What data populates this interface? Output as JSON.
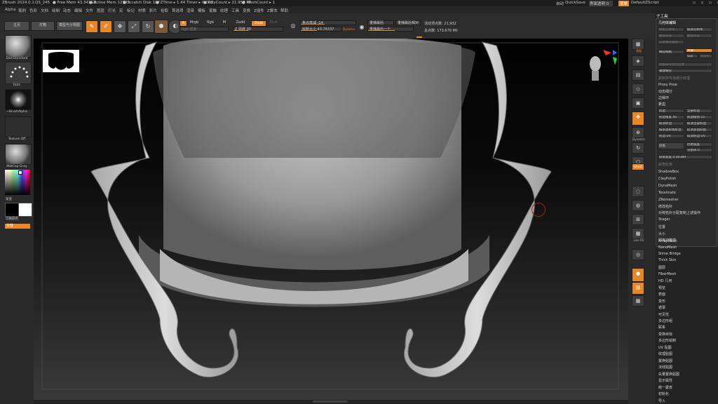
{
  "titlebar": {
    "app": "ZBrush 2024.0.1",
    "file": "QS_245",
    "free_mem": "● Free Mem 43.341GB",
    "active_mem": "● Active Mem 12732",
    "scratch": "● Scratch Disk 107",
    "ztime": "● ZTime ▸ 1.44 Timer ▸ 0.002",
    "polycount": "● PolyCount ▸ 21.958 KP",
    "meshcount": "● MeshCount ▸ 1",
    "autosave": "自动",
    "quicksave": "QuickSave",
    "transparency": "界面透明 0",
    "menus_btn": "菜单",
    "zscript": "DefaultZScript"
  },
  "menubar": [
    "Alpha",
    "笔刷",
    "色彩",
    "文档",
    "绘制",
    "动态",
    "编辑",
    "文件",
    "图层",
    "灯光",
    "宏",
    "标记",
    "材质",
    "影片",
    "拾取",
    "首选项",
    "渲染",
    "模板",
    "笔触",
    "纹理",
    "工具",
    "变换",
    "Z插件",
    "Z脚本",
    "帮助"
  ],
  "topshelf": {
    "home": "主页",
    "lightbox": "灯箱",
    "spotlight": "模型与分裂图",
    "edit": "编辑",
    "draw": "绘制",
    "move": "移动",
    "scale": "缩放",
    "rotate": "旋转",
    "a": "A",
    "mrgb": "Mrgb",
    "rgb": "Rgb",
    "m": "M",
    "zadd": "Zadd",
    "zsub": "Zsub",
    "zcut": "Zcut",
    "rgb_intensity": "Rgb 强度",
    "z_intensity": "Z 强度 30",
    "focal_shift": "焦点衰减 -14",
    "draw_size": "绘制大小 43.76337",
    "dynamic": "Dynamic",
    "replay_last": "重播最后",
    "replay_last_rel": "重播最后相对",
    "replay_all": "重播最后一个",
    "active_points": "活动顶点数: 21,932",
    "total_points": "总点数: 173,670 Mil"
  },
  "leftshelf": {
    "brush1": "DamStandard",
    "brush2": "Dots",
    "brush3": "~BrushAlpha",
    "texture": "Texture Off",
    "material": "MatCap Gray",
    "gradient": "渐变",
    "swap": "切换颜色",
    "alt": "交替"
  },
  "rightshelf": [
    "透视",
    "地面",
    "局部",
    "移动",
    "缩放",
    "旋转",
    "Dynamic",
    "线框",
    "透明",
    "Ghost",
    "PolyF",
    "单独",
    "Line Fill",
    "Xpose",
    "Bpr"
  ],
  "tray": {
    "title": "子工具",
    "panel_title": "几何体编辑",
    "lower_res": "降低分辨率",
    "higher_res": "提高分辨率",
    "del_lower": "删除较低",
    "del_higher": "删除较高",
    "freeze": "冻结细分级别",
    "reconstruct": "重建细分",
    "divide": "细分网格",
    "smt": "平滑",
    "suv": "Suv",
    "rsmt": "Rsmt",
    "convert_bpr": "转换BPR为几何体",
    "retopo": "重建细分",
    "copy_subd": "复制并传递细分纹理",
    "proxy": "Proxy Pose",
    "dynamic_subd": "动态细分",
    "edge_loop": "边缘环",
    "crease": "折边",
    "crease_btn": "折边",
    "crease_all": "全部折边",
    "crease_angle": "折边角度 45",
    "crease_level": "折边级别 15",
    "uncrease": "取消折边",
    "uncrease_all": "取消全部折边",
    "crease_pg": "按多边形组折边",
    "uncrease_pg": "取消多边形组",
    "crease_uv": "折边 UV",
    "uncrease_uv": "取消折边 UV",
    "bevel": "斜角",
    "bevel_width": "斜角宽度 0.00389",
    "bevel_ratio": "比例宽度",
    "bevel_falloff": "分割率 0",
    "bevel_profile": "斜角轮廓",
    "shadowbox": "ShadowBox",
    "claypolish": "ClayPolish",
    "dynamesh": "DynaMesh",
    "tessimate": "Tessimate",
    "zremesher": "ZRemesher",
    "modify_topo": "修改拓扑",
    "pos_sync": "对称拓扑分配复制上述操作",
    "stager": "Stager",
    "position": "位置",
    "size": "大小",
    "mesh_integrity": "网格完整性",
    "list": [
      "ArrayMesh",
      "NanoMesh",
      "Slime Bridge",
      "Thick Skin",
      "图层",
      "FiberMesh",
      "HD 几何",
      "预览",
      "表面",
      "变形",
      "遮罩",
      "可见性",
      "多边形组",
      "联系",
      "变换目标",
      "多边形绘制",
      "UV 贴图",
      "纹理贴图",
      "置换贴图",
      "法线贴图",
      "矢量置换贴图",
      "显示属性",
      "统一蒙皮",
      "初始化",
      "导入"
    ]
  },
  "colors": {
    "accent": "#e8862a"
  }
}
